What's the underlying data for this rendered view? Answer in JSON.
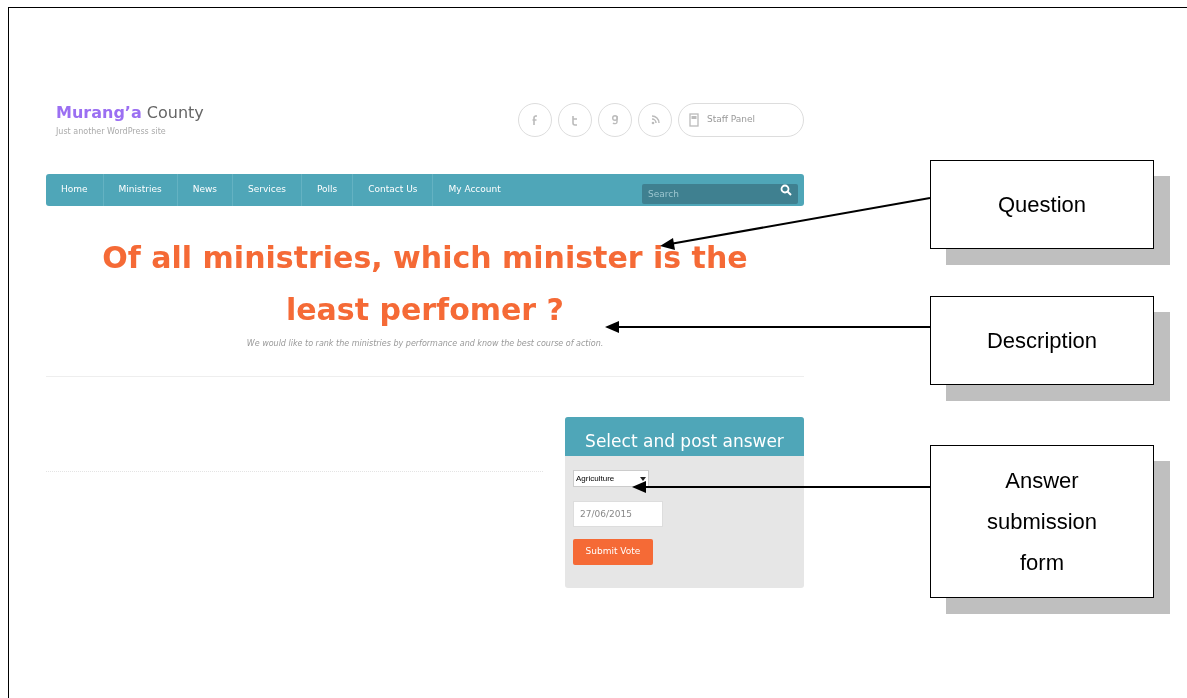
{
  "site": {
    "name_first": "Murang’a",
    "name_second": "County",
    "tagline": "Just another WordPress site"
  },
  "social": [
    {
      "kind": "facebook"
    },
    {
      "kind": "twitter"
    },
    {
      "kind": "google"
    },
    {
      "kind": "rss"
    }
  ],
  "staff_panel": "Staff Panel",
  "nav": {
    "items": [
      "Home",
      "Ministries",
      "News",
      "Services",
      "Polls",
      "Contact Us",
      "My Account"
    ],
    "search_placeholder": "Search"
  },
  "poll": {
    "question": "Of all ministries, which minister is the least perfomer ?",
    "description": "We would like to rank the ministries  by performance and know the best course of action."
  },
  "answer_form": {
    "title": "Select and post answer",
    "select_value": "Agriculture",
    "date_value": "27/06/2015",
    "submit": "Submit Vote"
  },
  "callouts": [
    {
      "text": "Question"
    },
    {
      "text": "Description"
    },
    {
      "text": "Answer submission form"
    }
  ]
}
